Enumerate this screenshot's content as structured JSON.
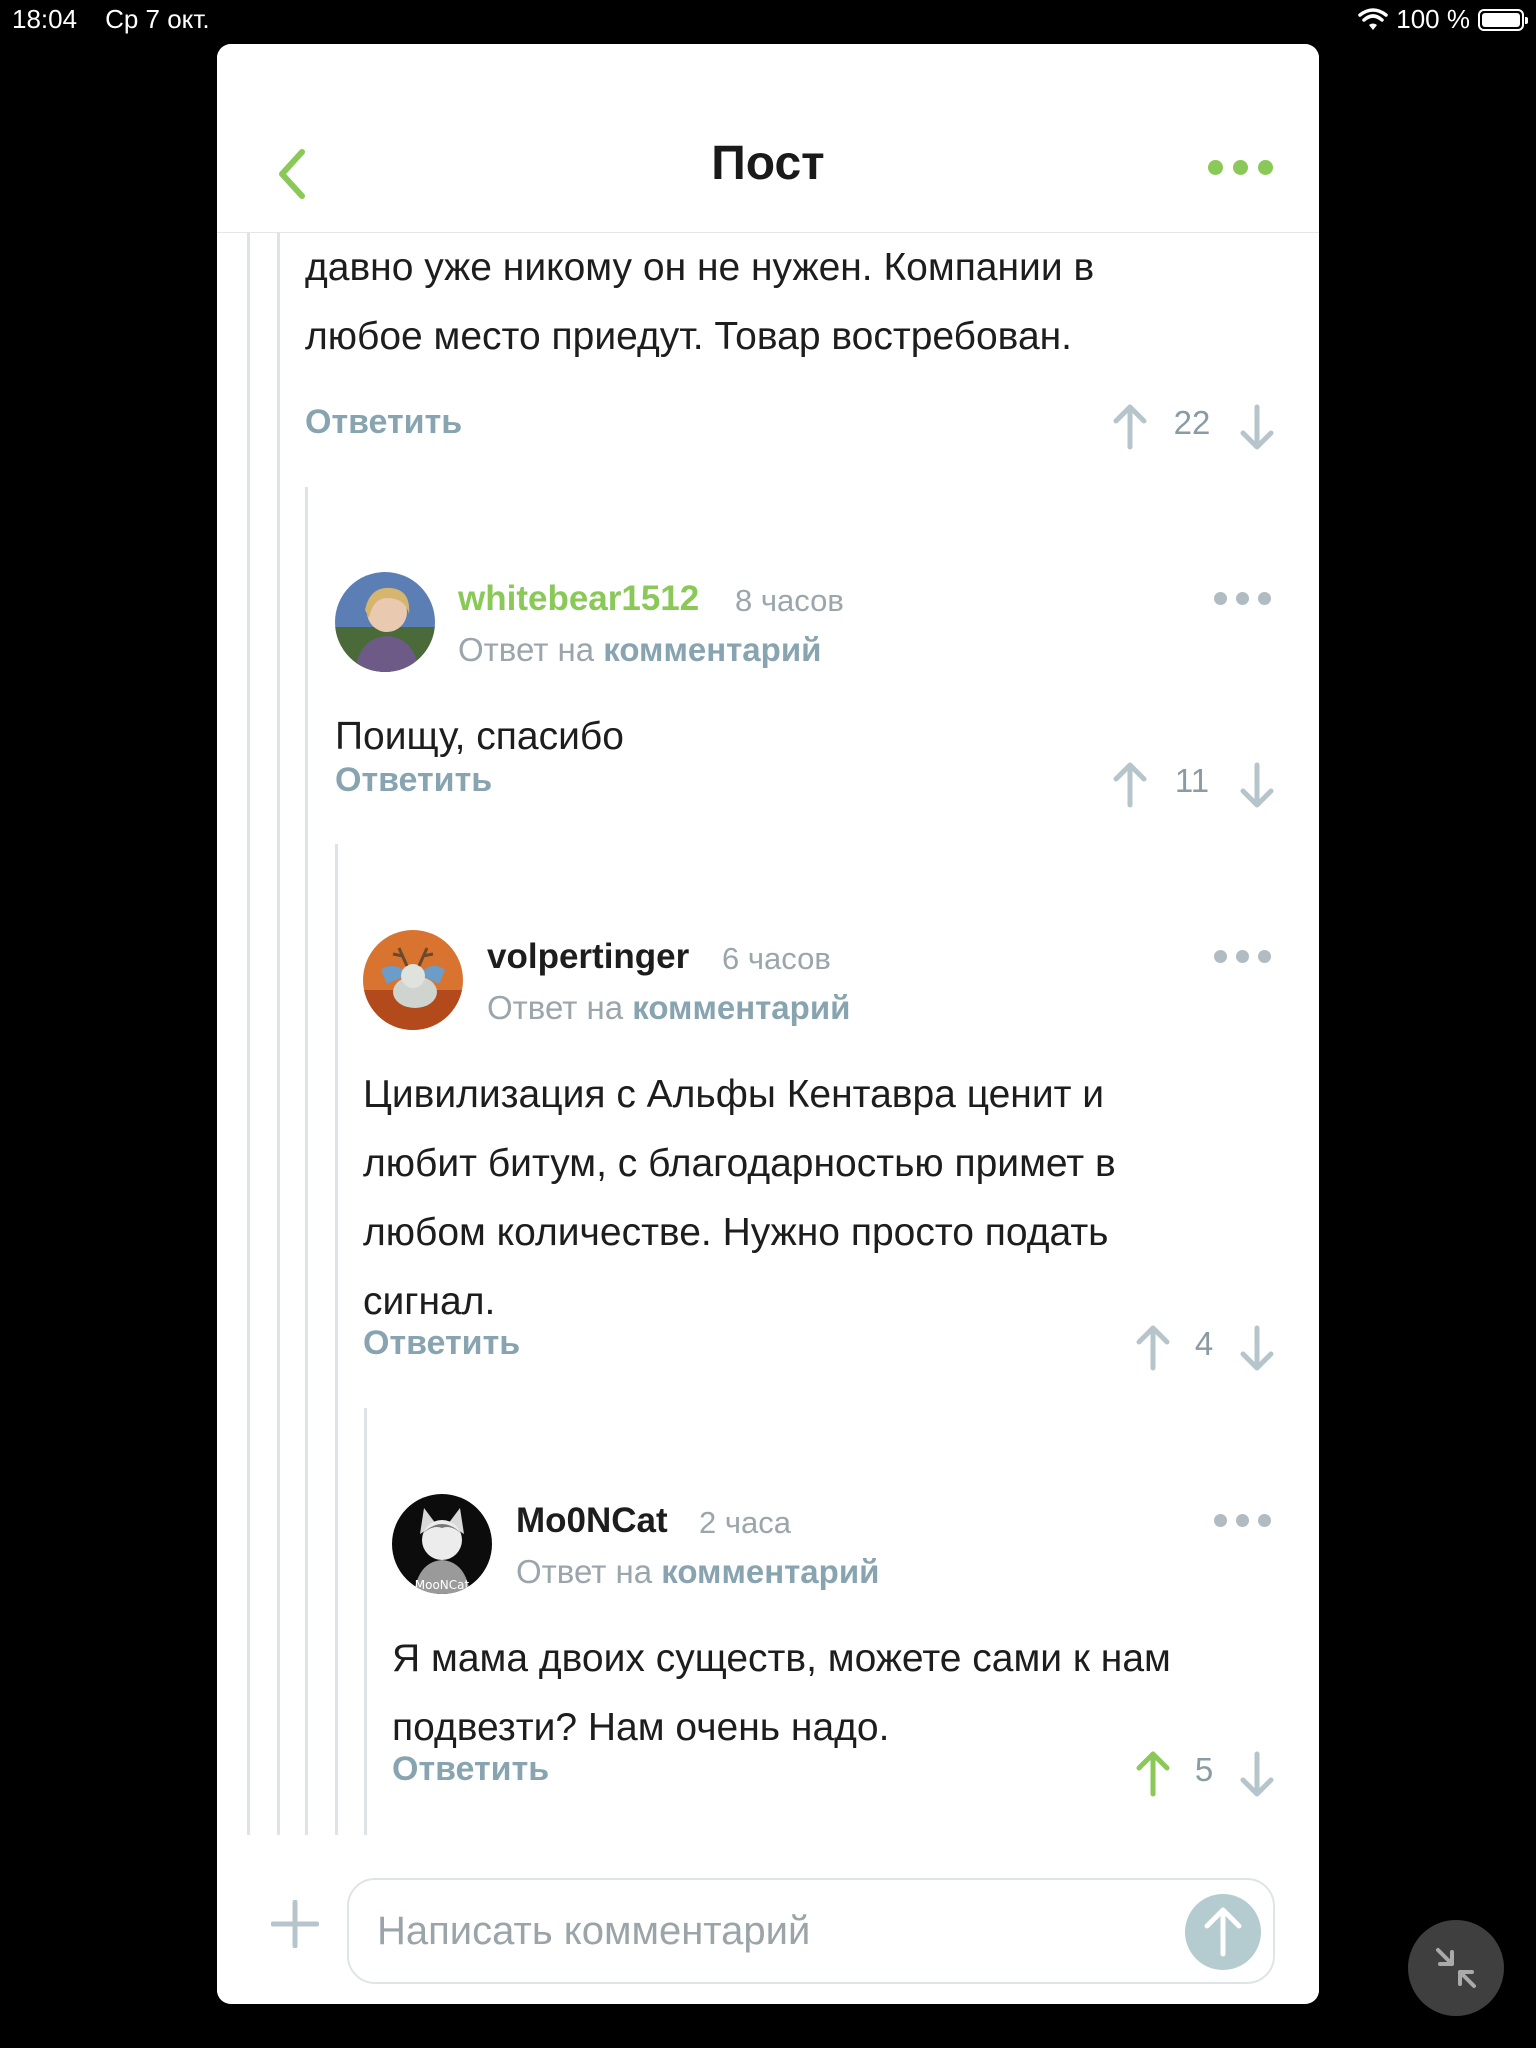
{
  "status_bar": {
    "time": "18:04",
    "date": "Ср 7 окт.",
    "battery": "100 %"
  },
  "header": {
    "title": "Пост"
  },
  "comments": [
    {
      "text_lines": [
        "давно уже никому он не нужен. Компании в",
        "любое место приедут. Товар востребован."
      ],
      "reply_label": "Ответить",
      "score": "22"
    },
    {
      "username": "whitebear1512",
      "username_color": "#8ac858",
      "time": "8 часов",
      "reply_prefix": "Ответ на",
      "reply_link": "комментарий",
      "text_lines": [
        "Поищу, спасибо"
      ],
      "reply_label": "Ответить",
      "score": "11"
    },
    {
      "username": "volpertinger",
      "username_color": "#1d1d1d",
      "time": "6 часов",
      "reply_prefix": "Ответ на",
      "reply_link": "комментарий",
      "text_lines": [
        "Цивилизация с Альфы Кентавра ценит и",
        "любит битум, с благодарностью примет в",
        "любом количестве. Нужно просто подать",
        "сигнал."
      ],
      "reply_label": "Ответить",
      "score": "4"
    },
    {
      "username": "Mo0NCat",
      "username_color": "#1d1d1d",
      "time": "2 часа",
      "reply_prefix": "Ответ на",
      "reply_link": "комментарий",
      "text_lines": [
        "Я мама двоих существ, можете сами к нам",
        "подвезти? Нам очень надо."
      ],
      "reply_label": "Ответить",
      "score": "5",
      "upvoted": true,
      "avatar_caption": "MooNCat"
    }
  ],
  "compose": {
    "placeholder": "Написать комментарий"
  },
  "colors": {
    "accent": "#8ac858",
    "muted": "#87a4b0",
    "vote": "#b5c5cb"
  },
  "icons": [
    "chevron-left-icon",
    "more-icon",
    "arrow-up-icon",
    "arrow-down-icon",
    "plus-icon",
    "send-icon",
    "wifi-icon",
    "battery-icon",
    "collapse-icon"
  ]
}
